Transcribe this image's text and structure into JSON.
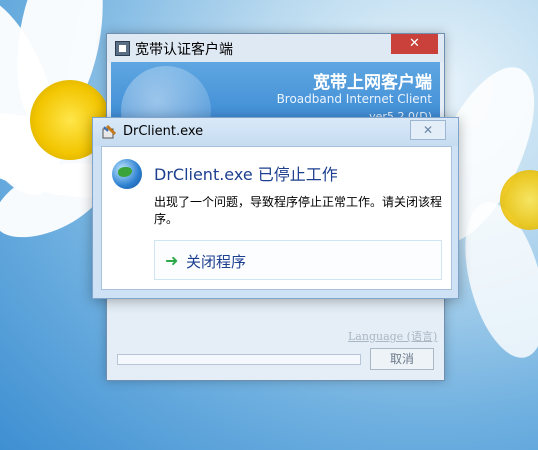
{
  "background_window": {
    "title": "宽带认证客户端",
    "close_symbol": "✕",
    "brand_cn": "宽带上网客户端",
    "brand_en": "Broadband Internet Client",
    "version": "ver5.2.0(D)",
    "language_link": "Language (语言)",
    "cancel_label": "取消",
    "progress": 0
  },
  "dialog": {
    "title": "DrClient.exe",
    "close_symbol": "✕",
    "heading": "DrClient.exe 已停止工作",
    "message": "出现了一个问题，导致程序停止正常工作。请关闭该程序。",
    "action_label": "关闭程序",
    "action_icon": "green-arrow-right-icon"
  },
  "colors": {
    "accent_heading": "#1d3f8f",
    "close_red": "#c9413a",
    "arrow_green": "#2fa84a"
  }
}
